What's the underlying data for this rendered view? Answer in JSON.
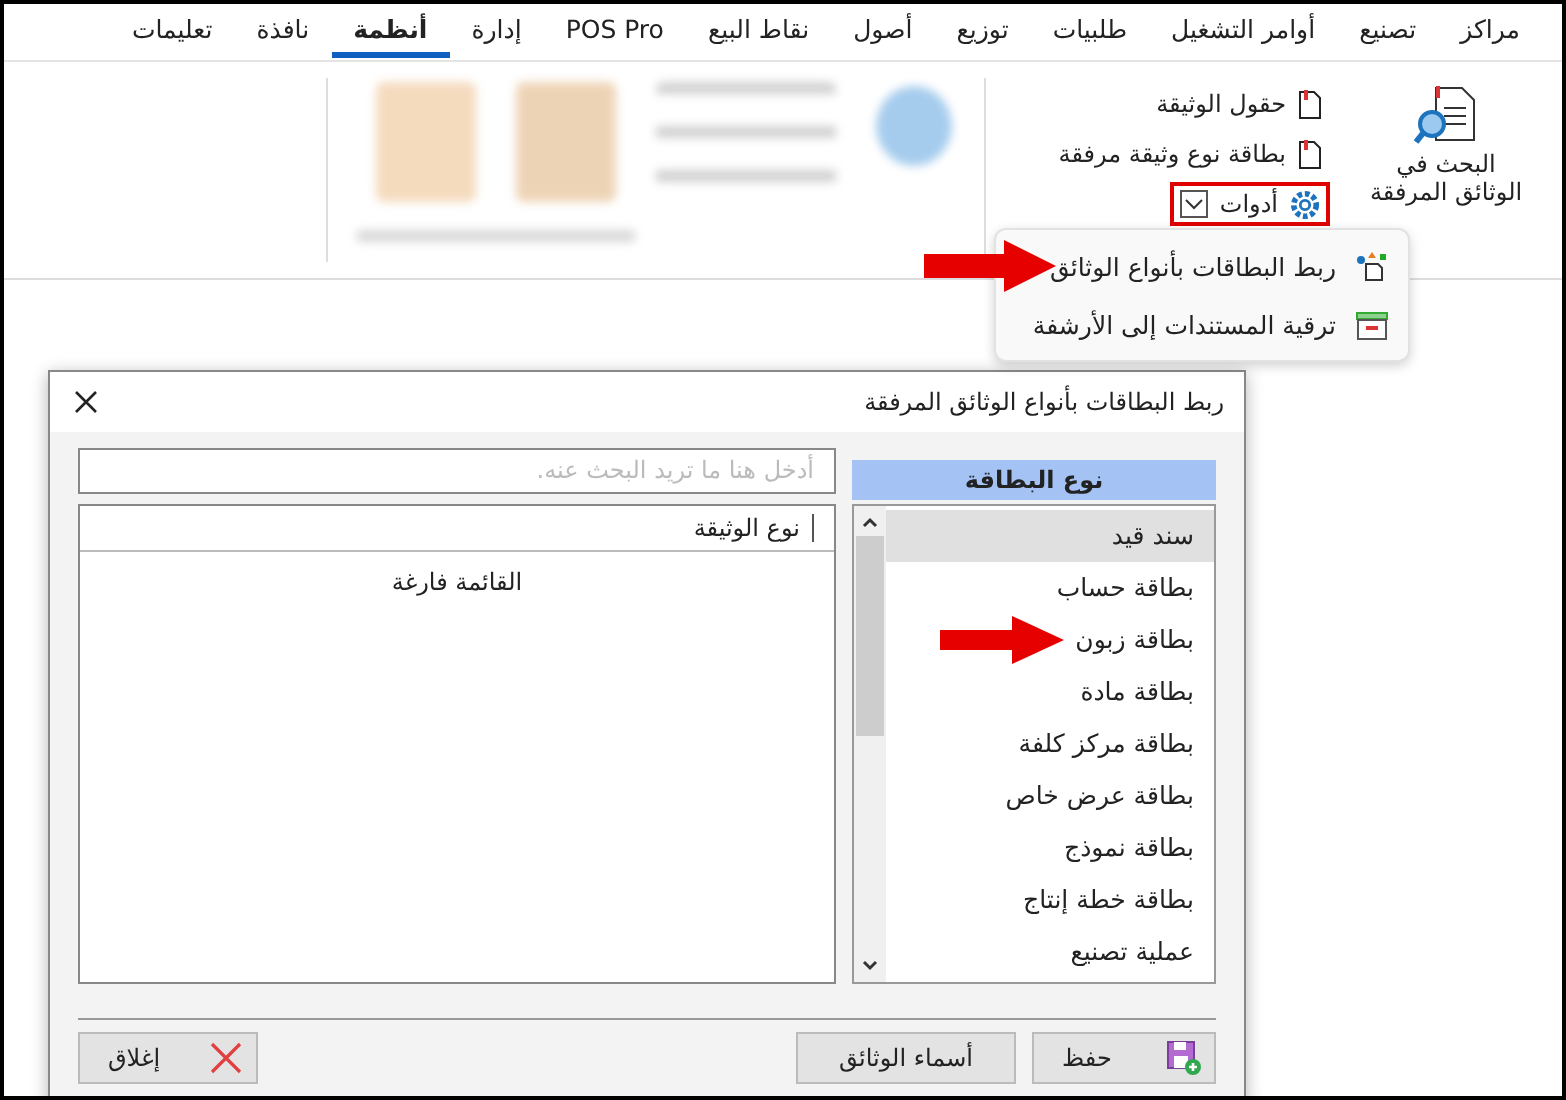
{
  "menu": [
    {
      "label": "مراكز",
      "selected": false
    },
    {
      "label": "تصنيع",
      "selected": false
    },
    {
      "label": "أوامر التشغيل",
      "selected": false
    },
    {
      "label": "طلبيات",
      "selected": false
    },
    {
      "label": "توزيع",
      "selected": false
    },
    {
      "label": "أصول",
      "selected": false
    },
    {
      "label": "نقاط البيع",
      "selected": false
    },
    {
      "label": "POS Pro",
      "selected": false
    },
    {
      "label": "إدارة",
      "selected": false
    },
    {
      "label": "أنظمة",
      "selected": true
    },
    {
      "label": "نافذة",
      "selected": false
    },
    {
      "label": "تعليمات",
      "selected": false
    }
  ],
  "ribbon": {
    "search_button": {
      "lines": [
        "البحث في",
        "الوثائق المرفقة"
      ]
    },
    "items": [
      {
        "label": "حقول الوثيقة"
      },
      {
        "label": "بطاقة نوع وثيقة مرفقة"
      }
    ],
    "tools": {
      "label": "أدوات",
      "highlighted": true
    }
  },
  "dropdown": [
    {
      "kind": "link",
      "label": "ربط البطاقات بأنواع الوثائق",
      "pointed": true
    },
    {
      "kind": "archive",
      "label": "ترقية المستندات إلى الأرشفة",
      "pointed": false
    }
  ],
  "dialog": {
    "title": "ربط البطاقات بأنواع الوثائق المرفقة",
    "search": {
      "placeholder": "أدخل هنا ما تريد البحث عنه."
    },
    "table": {
      "columns": [
        "نوع الوثيقة"
      ],
      "empty_text": "القائمة فارغة"
    },
    "card_types": {
      "header": "نوع البطاقة",
      "items": [
        {
          "label": "سند قيد",
          "selected": true,
          "pointed": false
        },
        {
          "label": "بطاقة حساب",
          "selected": false,
          "pointed": false
        },
        {
          "label": "بطاقة زبون",
          "selected": false,
          "pointed": true
        },
        {
          "label": "بطاقة مادة",
          "selected": false,
          "pointed": false
        },
        {
          "label": "بطاقة مركز كلفة",
          "selected": false,
          "pointed": false
        },
        {
          "label": "بطاقة عرض خاص",
          "selected": false,
          "pointed": false
        },
        {
          "label": "بطاقة نموذج",
          "selected": false,
          "pointed": false
        },
        {
          "label": "بطاقة خطة إنتاج",
          "selected": false,
          "pointed": false
        },
        {
          "label": "عملية تصنيع",
          "selected": false,
          "pointed": false
        }
      ]
    },
    "buttons": [
      {
        "kind": "save",
        "label": "حفظ"
      },
      {
        "kind": "names",
        "label": "أسماء الوثائق"
      },
      {
        "kind": "close",
        "label": "إغلاق"
      }
    ]
  }
}
